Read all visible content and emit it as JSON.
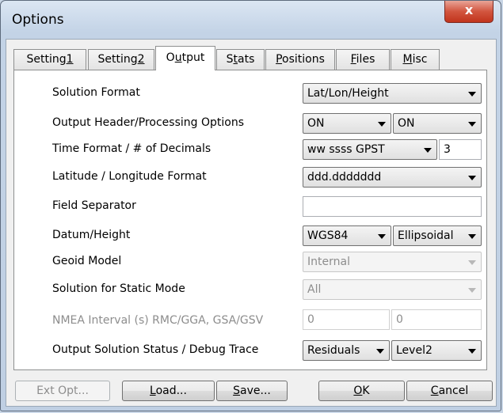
{
  "window": {
    "title": "Options",
    "close_label": "x"
  },
  "tabs": [
    {
      "pre": "Setting",
      "key": "1",
      "post": ""
    },
    {
      "pre": "Setting",
      "key": "2",
      "post": ""
    },
    {
      "pre": "O",
      "key": "u",
      "post": "tput"
    },
    {
      "pre": "S",
      "key": "t",
      "post": "ats"
    },
    {
      "pre": "",
      "key": "P",
      "post": "ositions"
    },
    {
      "pre": "",
      "key": "F",
      "post": "iles"
    },
    {
      "pre": "",
      "key": "M",
      "post": "isc"
    }
  ],
  "active_tab": "Output",
  "rows": {
    "solution_format": {
      "label": "Solution Format",
      "value": "Lat/Lon/Height"
    },
    "output_header": {
      "label": "Output Header/Processing Options",
      "value1": "ON",
      "value2": "ON"
    },
    "time_format": {
      "label": "Time Format / # of Decimals",
      "value": "ww ssss GPST",
      "decimals": "3"
    },
    "latlon_format": {
      "label": "Latitude / Longitude Format",
      "value": "ddd.ddddddd"
    },
    "field_separator": {
      "label": "Field Separator",
      "value": ""
    },
    "datum_height": {
      "label": "Datum/Height",
      "datum": "WGS84",
      "height": "Ellipsoidal"
    },
    "geoid_model": {
      "label": "Geoid Model",
      "value": "Internal"
    },
    "static_mode": {
      "label": "Solution for Static Mode",
      "value": "All"
    },
    "nmea_interval": {
      "label": "NMEA Interval (s) RMC/GGA, GSA/GSV",
      "value1": "0",
      "value2": "0"
    },
    "solution_status": {
      "label": "Output Solution Status / Debug Trace",
      "status": "Residuals",
      "trace": "Level2"
    }
  },
  "buttons": {
    "ext_opt": "Ext Opt...",
    "load": {
      "pre": "",
      "key": "L",
      "post": "oad..."
    },
    "save": {
      "pre": "",
      "key": "S",
      "post": "ave..."
    },
    "ok": {
      "pre": "",
      "key": "O",
      "post": "K"
    },
    "cancel": {
      "pre": "",
      "key": "C",
      "post": "ancel"
    }
  }
}
